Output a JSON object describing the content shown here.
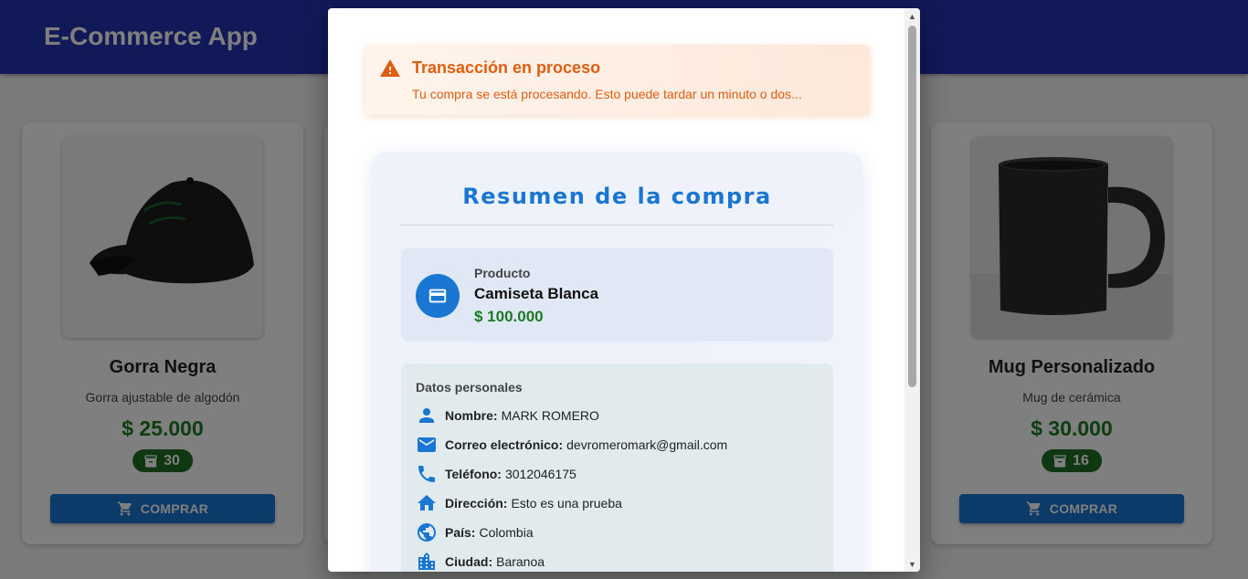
{
  "app": {
    "title": "E-Commerce App"
  },
  "products": [
    {
      "name": "Gorra Negra",
      "description": "Gorra ajustable de algodón",
      "price": "$ 25.000",
      "stock": "30",
      "button": "COMPRAR",
      "image_icon": "cap-image"
    },
    {
      "name": "Mug Personalizado",
      "description": "Mug de cerámica",
      "price": "$ 30.000",
      "stock": "16",
      "button": "COMPRAR",
      "image_icon": "mug-image"
    }
  ],
  "dialog": {
    "alert": {
      "title": "Transacción en proceso",
      "message": "Tu compra se está procesando. Esto puede tardar un minuto o dos...",
      "icon": "warning-icon",
      "color": "#e05d0f"
    },
    "summary": {
      "title": "Resumen de la compra",
      "product_label": "Producto",
      "product_name": "Camiseta Blanca",
      "product_price": "$ 100.000",
      "product_icon": "credit-card-icon"
    },
    "personal": {
      "title": "Datos personales",
      "fields": [
        {
          "label": "Nombre:",
          "value": "MARK ROMERO",
          "icon": "person-icon"
        },
        {
          "label": "Correo electrónico:",
          "value": "devromeromark@gmail.com",
          "icon": "email-icon"
        },
        {
          "label": "Teléfono:",
          "value": "3012046175",
          "icon": "phone-icon"
        },
        {
          "label": "Dirección:",
          "value": "Esto es una prueba",
          "icon": "home-icon"
        },
        {
          "label": "País:",
          "value": "Colombia",
          "icon": "globe-icon"
        },
        {
          "label": "Ciudad:",
          "value": "Baranoa",
          "icon": "city-icon"
        }
      ]
    }
  },
  "colors": {
    "appbar": "#2232b0",
    "primary": "#1976d2",
    "price": "#1b7a23",
    "stock_badge": "#1f6e24"
  }
}
